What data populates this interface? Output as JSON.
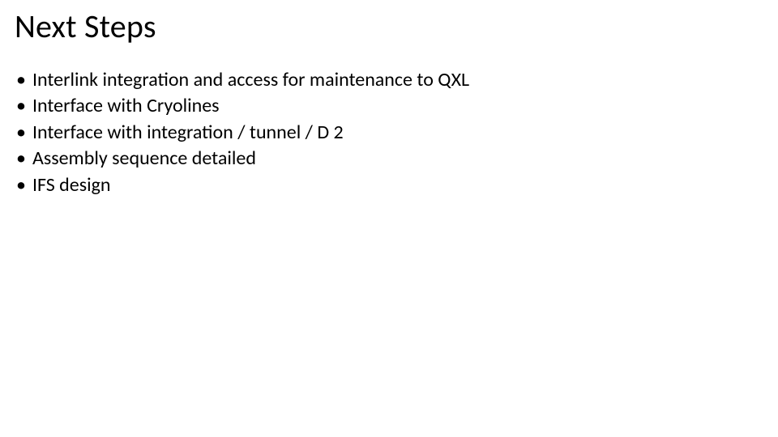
{
  "title": "Next Steps",
  "bullets": [
    "Interlink integration and access for maintenance to QXL",
    "Interface with Cryolines",
    "Interface with integration / tunnel / D 2",
    "Assembly sequence detailed",
    "IFS design"
  ]
}
